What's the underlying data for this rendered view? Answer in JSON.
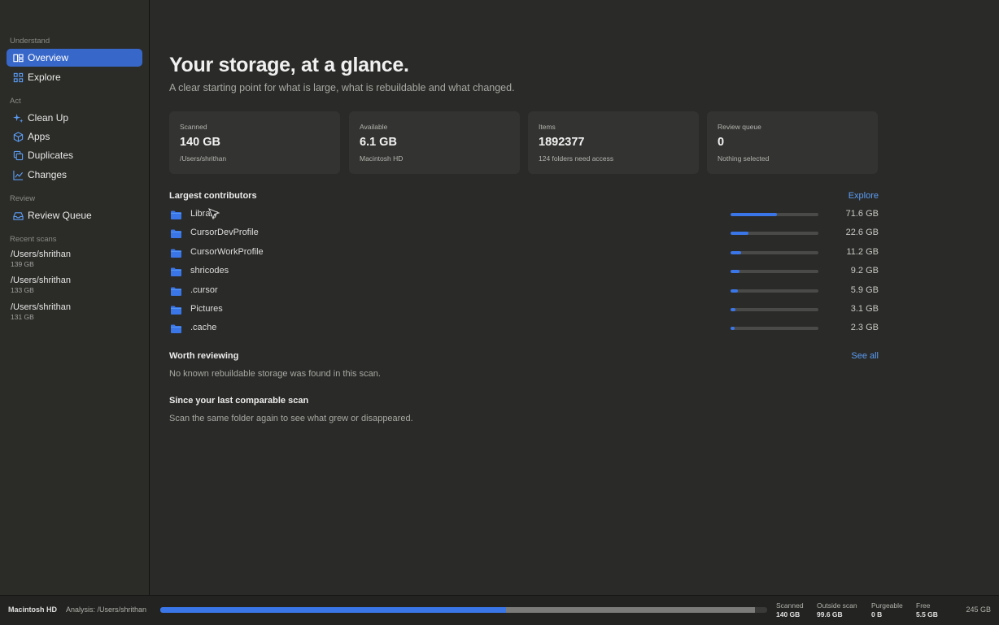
{
  "sidebar": {
    "sections": {
      "understand": "Understand",
      "act": "Act",
      "review": "Review",
      "recent": "Recent scans"
    },
    "items": [
      {
        "label": "Overview",
        "icon": "overview-icon",
        "active": true
      },
      {
        "label": "Explore",
        "icon": "grid-icon"
      },
      {
        "label": "Clean Up",
        "icon": "sparkle-icon"
      },
      {
        "label": "Apps",
        "icon": "cube-icon"
      },
      {
        "label": "Duplicates",
        "icon": "duplicate-icon"
      },
      {
        "label": "Changes",
        "icon": "chart-icon"
      },
      {
        "label": "Review Queue",
        "icon": "tray-icon"
      }
    ],
    "recent_scans": [
      {
        "path": "/Users/shrithan",
        "size": "139 GB"
      },
      {
        "path": "/Users/shrithan",
        "size": "133 GB"
      },
      {
        "path": "/Users/shrithan",
        "size": "131 GB"
      }
    ]
  },
  "main": {
    "title": "Your storage, at a glance.",
    "subtitle": "A clear starting point for what is large, what is rebuildable and what changed.",
    "cards": [
      {
        "label": "Scanned",
        "value": "140 GB",
        "detail": "/Users/shrithan"
      },
      {
        "label": "Available",
        "value": "6.1 GB",
        "detail": "Macintosh HD"
      },
      {
        "label": "Items",
        "value": "1892377",
        "detail": "124 folders need access"
      },
      {
        "label": "Review queue",
        "value": "0",
        "detail": "Nothing selected"
      }
    ],
    "contributors": {
      "heading": "Largest contributors",
      "link": "Explore",
      "rows": [
        {
          "name": "Library",
          "size": "71.6 GB",
          "fraction": 0.53
        },
        {
          "name": "CursorDevProfile",
          "size": "22.6 GB",
          "fraction": 0.2
        },
        {
          "name": "CursorWorkProfile",
          "size": "11.2 GB",
          "fraction": 0.12
        },
        {
          "name": "shricodes",
          "size": "9.2 GB",
          "fraction": 0.1
        },
        {
          "name": ".cursor",
          "size": "5.9 GB",
          "fraction": 0.08
        },
        {
          "name": "Pictures",
          "size": "3.1 GB",
          "fraction": 0.06
        },
        {
          "name": ".cache",
          "size": "2.3 GB",
          "fraction": 0.05
        }
      ]
    },
    "worth_reviewing": {
      "heading": "Worth reviewing",
      "link": "See all",
      "text": "No known rebuildable storage was found in this scan."
    },
    "since_last": {
      "heading": "Since your last comparable scan",
      "text": "Scan the same folder again to see what grew or disappeared."
    }
  },
  "footer": {
    "volume": "Macintosh HD",
    "analysis": "Analysis: /Users/shrithan",
    "scanned_fraction": 0.57,
    "outside_fraction": 0.41,
    "stats": [
      {
        "label": "Scanned",
        "value": "140 GB"
      },
      {
        "label": "Outside scan",
        "value": "99.6 GB"
      },
      {
        "label": "Purgeable",
        "value": "0 B"
      },
      {
        "label": "Free",
        "value": "5.5 GB"
      }
    ],
    "total": "245 GB"
  },
  "colors": {
    "accent": "#3a76e8",
    "link": "#5b9df5",
    "active_nav": "#3767c9",
    "bar_gray": "#7b7b79"
  }
}
